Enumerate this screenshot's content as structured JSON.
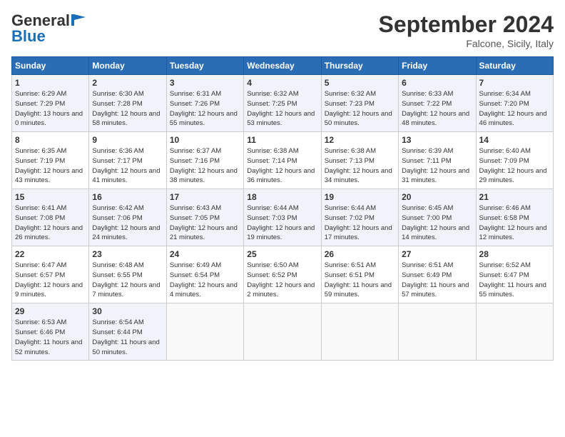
{
  "header": {
    "logo_general": "General",
    "logo_blue": "Blue",
    "month": "September 2024",
    "location": "Falcone, Sicily, Italy"
  },
  "days_of_week": [
    "Sunday",
    "Monday",
    "Tuesday",
    "Wednesday",
    "Thursday",
    "Friday",
    "Saturday"
  ],
  "weeks": [
    [
      {
        "day": 1,
        "sunrise": "6:29 AM",
        "sunset": "7:29 PM",
        "daylight": "13 hours and 0 minutes."
      },
      {
        "day": 2,
        "sunrise": "6:30 AM",
        "sunset": "7:28 PM",
        "daylight": "12 hours and 58 minutes."
      },
      {
        "day": 3,
        "sunrise": "6:31 AM",
        "sunset": "7:26 PM",
        "daylight": "12 hours and 55 minutes."
      },
      {
        "day": 4,
        "sunrise": "6:32 AM",
        "sunset": "7:25 PM",
        "daylight": "12 hours and 53 minutes."
      },
      {
        "day": 5,
        "sunrise": "6:32 AM",
        "sunset": "7:23 PM",
        "daylight": "12 hours and 50 minutes."
      },
      {
        "day": 6,
        "sunrise": "6:33 AM",
        "sunset": "7:22 PM",
        "daylight": "12 hours and 48 minutes."
      },
      {
        "day": 7,
        "sunrise": "6:34 AM",
        "sunset": "7:20 PM",
        "daylight": "12 hours and 46 minutes."
      }
    ],
    [
      {
        "day": 8,
        "sunrise": "6:35 AM",
        "sunset": "7:19 PM",
        "daylight": "12 hours and 43 minutes."
      },
      {
        "day": 9,
        "sunrise": "6:36 AM",
        "sunset": "7:17 PM",
        "daylight": "12 hours and 41 minutes."
      },
      {
        "day": 10,
        "sunrise": "6:37 AM",
        "sunset": "7:16 PM",
        "daylight": "12 hours and 38 minutes."
      },
      {
        "day": 11,
        "sunrise": "6:38 AM",
        "sunset": "7:14 PM",
        "daylight": "12 hours and 36 minutes."
      },
      {
        "day": 12,
        "sunrise": "6:38 AM",
        "sunset": "7:13 PM",
        "daylight": "12 hours and 34 minutes."
      },
      {
        "day": 13,
        "sunrise": "6:39 AM",
        "sunset": "7:11 PM",
        "daylight": "12 hours and 31 minutes."
      },
      {
        "day": 14,
        "sunrise": "6:40 AM",
        "sunset": "7:09 PM",
        "daylight": "12 hours and 29 minutes."
      }
    ],
    [
      {
        "day": 15,
        "sunrise": "6:41 AM",
        "sunset": "7:08 PM",
        "daylight": "12 hours and 26 minutes."
      },
      {
        "day": 16,
        "sunrise": "6:42 AM",
        "sunset": "7:06 PM",
        "daylight": "12 hours and 24 minutes."
      },
      {
        "day": 17,
        "sunrise": "6:43 AM",
        "sunset": "7:05 PM",
        "daylight": "12 hours and 21 minutes."
      },
      {
        "day": 18,
        "sunrise": "6:44 AM",
        "sunset": "7:03 PM",
        "daylight": "12 hours and 19 minutes."
      },
      {
        "day": 19,
        "sunrise": "6:44 AM",
        "sunset": "7:02 PM",
        "daylight": "12 hours and 17 minutes."
      },
      {
        "day": 20,
        "sunrise": "6:45 AM",
        "sunset": "7:00 PM",
        "daylight": "12 hours and 14 minutes."
      },
      {
        "day": 21,
        "sunrise": "6:46 AM",
        "sunset": "6:58 PM",
        "daylight": "12 hours and 12 minutes."
      }
    ],
    [
      {
        "day": 22,
        "sunrise": "6:47 AM",
        "sunset": "6:57 PM",
        "daylight": "12 hours and 9 minutes."
      },
      {
        "day": 23,
        "sunrise": "6:48 AM",
        "sunset": "6:55 PM",
        "daylight": "12 hours and 7 minutes."
      },
      {
        "day": 24,
        "sunrise": "6:49 AM",
        "sunset": "6:54 PM",
        "daylight": "12 hours and 4 minutes."
      },
      {
        "day": 25,
        "sunrise": "6:50 AM",
        "sunset": "6:52 PM",
        "daylight": "12 hours and 2 minutes."
      },
      {
        "day": 26,
        "sunrise": "6:51 AM",
        "sunset": "6:51 PM",
        "daylight": "11 hours and 59 minutes."
      },
      {
        "day": 27,
        "sunrise": "6:51 AM",
        "sunset": "6:49 PM",
        "daylight": "11 hours and 57 minutes."
      },
      {
        "day": 28,
        "sunrise": "6:52 AM",
        "sunset": "6:47 PM",
        "daylight": "11 hours and 55 minutes."
      }
    ],
    [
      {
        "day": 29,
        "sunrise": "6:53 AM",
        "sunset": "6:46 PM",
        "daylight": "11 hours and 52 minutes."
      },
      {
        "day": 30,
        "sunrise": "6:54 AM",
        "sunset": "6:44 PM",
        "daylight": "11 hours and 50 minutes."
      },
      null,
      null,
      null,
      null,
      null
    ]
  ]
}
